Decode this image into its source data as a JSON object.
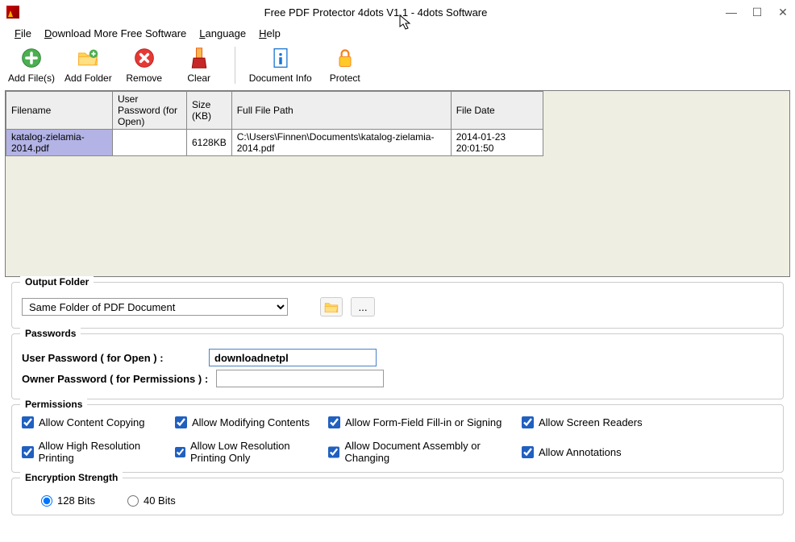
{
  "window": {
    "title": "Free PDF Protector 4dots V1.1 - 4dots Software"
  },
  "menu": {
    "file": "File",
    "download": "Download More Free Software",
    "language": "Language",
    "help": "Help"
  },
  "toolbar": {
    "add_files": "Add File(s)",
    "add_folder": "Add Folder",
    "remove": "Remove",
    "clear": "Clear",
    "doc_info": "Document Info",
    "protect": "Protect"
  },
  "grid": {
    "headers": {
      "filename": "Filename",
      "user_password": "User Password (for Open)",
      "size": "Size (KB)",
      "full_path": "Full File Path",
      "file_date": "File Date"
    },
    "rows": [
      {
        "filename": "katalog-zielamia-2014.pdf",
        "user_password": "",
        "size": "6128KB",
        "full_path": "C:\\Users\\Finnen\\Documents\\katalog-zielamia-2014.pdf",
        "file_date": "2014-01-23 20:01:50"
      }
    ]
  },
  "output": {
    "title": "Output Folder",
    "dropdown_value": "Same Folder of PDF Document",
    "browse_dots": "..."
  },
  "passwords": {
    "title": "Passwords",
    "user_label": "User Password ( for Open ) :",
    "user_value": "downloadnetpl",
    "owner_label": "Owner Password ( for Permissions ) :",
    "owner_value": ""
  },
  "permissions": {
    "title": "Permissions",
    "items": [
      "Allow Content Copying",
      "Allow Modifying Contents",
      "Allow Form-Field Fill-in or Signing",
      "Allow Screen Readers",
      "Allow High Resolution Printing",
      "Allow Low Resolution Printing Only",
      "Allow Document Assembly or Changing",
      "Allow Annotations"
    ]
  },
  "encryption": {
    "title": "Encryption Strength",
    "opt128": "128 Bits",
    "opt40": "40 Bits"
  }
}
